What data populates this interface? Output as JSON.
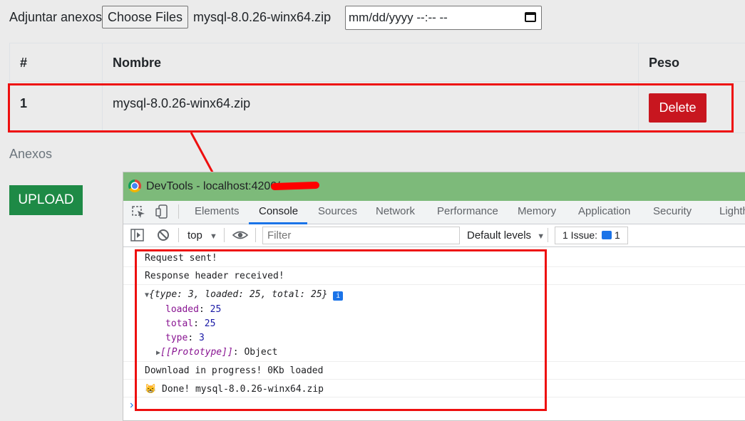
{
  "form": {
    "attach_label": "Adjuntar anexos",
    "choose_files_label": "Choose Files",
    "chosen_filename": "mysql-8.0.26-winx64.zip",
    "date_placeholder": "mm/dd/yyyy  --:-- --"
  },
  "table": {
    "headers": [
      "#",
      "Nombre",
      "Peso"
    ],
    "rows": [
      {
        "index": "1",
        "name": "mysql-8.0.26-winx64.zip",
        "delete_label": "Delete"
      }
    ]
  },
  "section_label": "Anexos",
  "upload_label": "UPLOAD",
  "devtools": {
    "title": "DevTools - localhost:4200/",
    "tabs": [
      "Elements",
      "Console",
      "Sources",
      "Network",
      "Performance",
      "Memory",
      "Application",
      "Security",
      "Lighthouse"
    ],
    "active_tab": "Console",
    "context": "top",
    "filter_placeholder": "Filter",
    "levels": "Default levels",
    "issues_label": "1 Issue:",
    "issues_count": "1",
    "console": {
      "line1": "Request sent!",
      "line2": "Response header received!",
      "obj_summary": "{type: 3, loaded: 25, total: 25}",
      "props": [
        {
          "key": "loaded",
          "value": "25"
        },
        {
          "key": "total",
          "value": "25"
        },
        {
          "key": "type",
          "value": "3"
        }
      ],
      "proto_key": "[[Prototype]]",
      "proto_value": "Object",
      "line3": "Download in progress! 0Kb loaded",
      "line4": "Done! mysql-8.0.26-winx64.zip",
      "emoji": "😸"
    }
  },
  "colors": {
    "delete": "#c8161f",
    "upload": "#1e8a46",
    "titlebar": "#7dba7a",
    "highlight": "#ee0f0f",
    "active_tab": "#1a73e8"
  }
}
